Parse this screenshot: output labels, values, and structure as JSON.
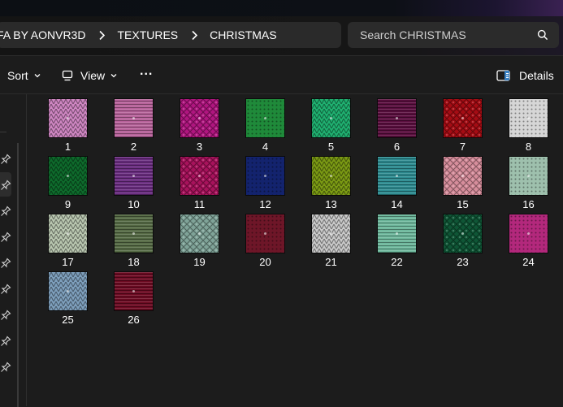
{
  "breadcrumb": {
    "items": [
      "FA BY AONVR3D",
      "TEXTURES",
      "CHRISTMAS"
    ]
  },
  "search": {
    "placeholder": "Search CHRISTMAS"
  },
  "toolbar": {
    "sort_label": "Sort",
    "view_label": "View",
    "more_label": "...",
    "details_label": "Details"
  },
  "files": [
    {
      "name": "1",
      "color": "#cf86c2"
    },
    {
      "name": "2",
      "color": "#b7619a"
    },
    {
      "name": "3",
      "color": "#b0157f"
    },
    {
      "name": "4",
      "color": "#1f8a3a"
    },
    {
      "name": "5",
      "color": "#1fb070"
    },
    {
      "name": "6",
      "color": "#5a0e3e"
    },
    {
      "name": "7",
      "color": "#a50c14"
    },
    {
      "name": "8",
      "color": "#d6d6d6"
    },
    {
      "name": "9",
      "color": "#0e6b2c"
    },
    {
      "name": "10",
      "color": "#6a2c80"
    },
    {
      "name": "11",
      "color": "#a8125c"
    },
    {
      "name": "12",
      "color": "#13236e"
    },
    {
      "name": "13",
      "color": "#7b9a14"
    },
    {
      "name": "14",
      "color": "#2d8c91"
    },
    {
      "name": "15",
      "color": "#d68d9b"
    },
    {
      "name": "16",
      "color": "#9ec0ad"
    },
    {
      "name": "17",
      "color": "#b9c7b0"
    },
    {
      "name": "18",
      "color": "#566b45"
    },
    {
      "name": "19",
      "color": "#7fa398"
    },
    {
      "name": "20",
      "color": "#6e1628"
    },
    {
      "name": "21",
      "color": "#c9c9c9"
    },
    {
      "name": "22",
      "color": "#6db89c"
    },
    {
      "name": "23",
      "color": "#0f5636"
    },
    {
      "name": "24",
      "color": "#b3287c"
    },
    {
      "name": "25",
      "color": "#7e9fbc"
    },
    {
      "name": "26",
      "color": "#6d0a22"
    }
  ]
}
